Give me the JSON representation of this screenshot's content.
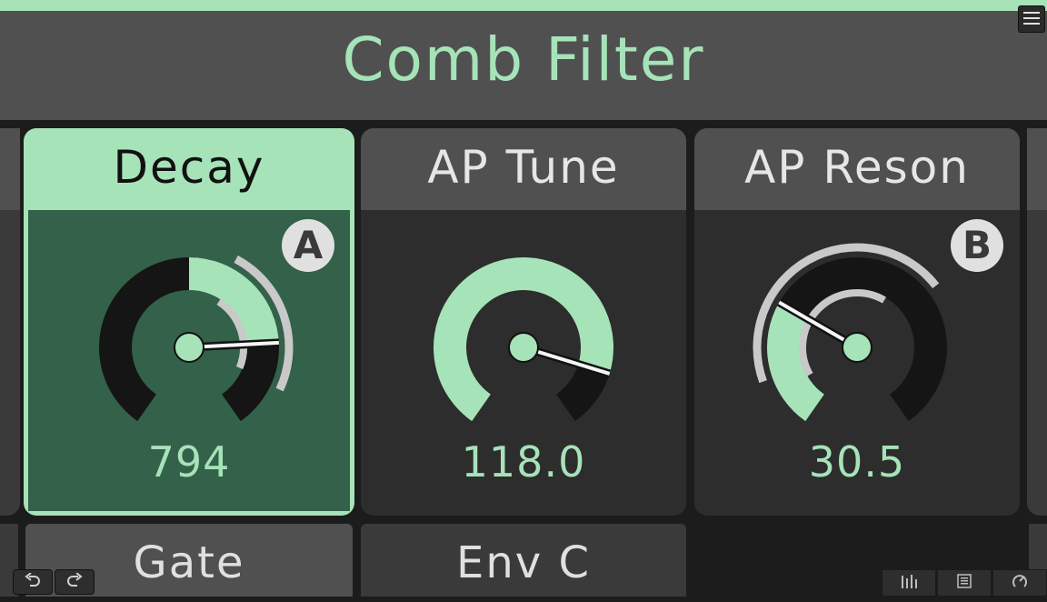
{
  "header": {
    "title": "Comb Filter"
  },
  "cards": [
    {
      "title": "Decay",
      "value": "794",
      "badge": "A"
    },
    {
      "title": "AP Tune",
      "value": "118.0"
    },
    {
      "title": "AP Reson",
      "value": "30.5",
      "badge": "B"
    }
  ],
  "bottom_cards": [
    {
      "title": "Gate"
    },
    {
      "title": "Env C"
    }
  ],
  "icons": {
    "menu": "menu-icon",
    "undo": "undo-icon",
    "redo": "redo-icon",
    "mixer": "mixer-icon",
    "list": "list-icon",
    "dial": "dial-icon"
  },
  "colors": {
    "accent": "#a6e3b8",
    "active_body": "#336149",
    "card_title_bg": "#505050",
    "card_body_bg": "#2d2d2d",
    "track": "#151515"
  }
}
